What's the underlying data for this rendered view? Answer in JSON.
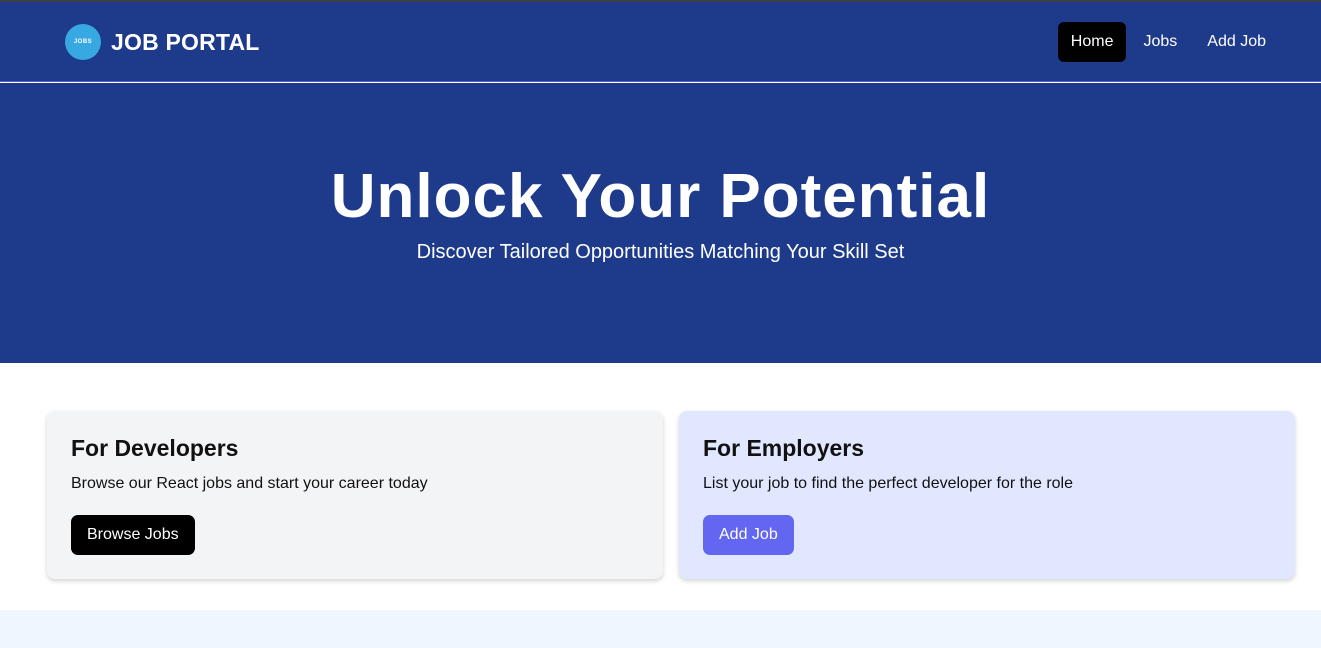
{
  "brand": {
    "logo_text": "JOBS",
    "title": "JOB PORTAL"
  },
  "nav": {
    "items": [
      {
        "label": "Home",
        "active": true
      },
      {
        "label": "Jobs",
        "active": false
      },
      {
        "label": "Add Job",
        "active": false
      }
    ]
  },
  "hero": {
    "title": "Unlock Your Potential",
    "subtitle": "Discover Tailored Opportunities Matching Your Skill Set"
  },
  "cards": {
    "developers": {
      "title": "For Developers",
      "description": "Browse our React jobs and start your career today",
      "button": "Browse Jobs"
    },
    "employers": {
      "title": "For Employers",
      "description": "List your job to find the perfect developer for the role",
      "button": "Add Job"
    }
  },
  "colors": {
    "primary": "#1e3a8a",
    "accent": "#6366f1",
    "employer_card": "#e0e7ff",
    "developer_card": "#f3f4f6",
    "logo": "#38a8e3"
  }
}
